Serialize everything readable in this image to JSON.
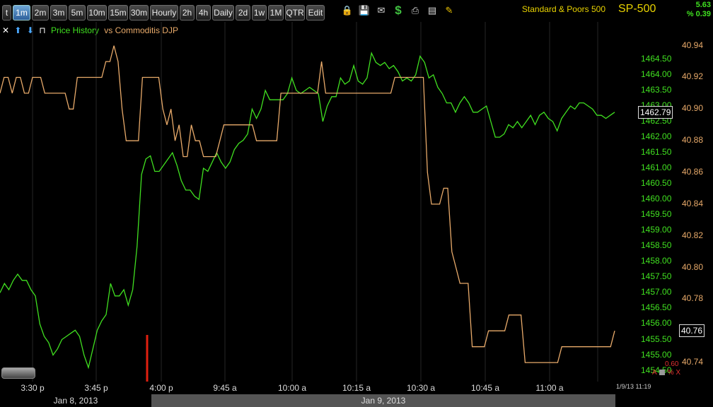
{
  "toolbar": {
    "timeframes": [
      {
        "label": "t",
        "active": false
      },
      {
        "label": "1m",
        "active": true
      },
      {
        "label": "2m",
        "active": false
      },
      {
        "label": "3m",
        "active": false
      },
      {
        "label": "5m",
        "active": false
      },
      {
        "label": "10m",
        "active": false
      },
      {
        "label": "15m",
        "active": false
      },
      {
        "label": "30m",
        "active": false
      },
      {
        "label": "Hourly",
        "active": false
      },
      {
        "label": "2h",
        "active": false
      },
      {
        "label": "4h",
        "active": false
      },
      {
        "label": "Daily",
        "active": false
      },
      {
        "label": "2d",
        "active": false
      },
      {
        "label": "1w",
        "active": false
      },
      {
        "label": "1M",
        "active": false
      },
      {
        "label": "QTR",
        "active": false
      },
      {
        "label": "Edit",
        "active": false
      }
    ],
    "icons": [
      "lock-icon",
      "save-icon",
      "mail-icon",
      "dollar-icon",
      "print-icon",
      "card-icon",
      "pencil-icon"
    ],
    "symbol_name": "Standard & Poors 500",
    "symbol": "SP-500",
    "change": "5.63",
    "change_pct": "% 0.39"
  },
  "legend": {
    "arrow_icons": [
      "close-icon",
      "arrow-up-icon",
      "arrow-down-icon",
      "pin-icon"
    ],
    "primary": "Price History",
    "compare": "vs Commoditis DJP"
  },
  "colors": {
    "price": "#40e020",
    "compare": "#e8aa6a",
    "grid": "#262626",
    "marker": "#e02010"
  },
  "chart_data": {
    "type": "line",
    "x_labels": [
      "3:30 p",
      "3:45 p",
      "4:00 p",
      "9:45 a",
      "10:00 a",
      "10:15 a",
      "10:30 a",
      "10:45 a",
      "11:00 a"
    ],
    "date_labels": [
      "Jan 8, 2013",
      "Jan 9, 2013"
    ],
    "y_left_ticks": [
      "1464.50",
      "1464.00",
      "1463.50",
      "1463.00",
      "1462.50",
      "1462.00",
      "1461.50",
      "1461.00",
      "1460.50",
      "1460.00",
      "1459.50",
      "1459.00",
      "1458.50",
      "1458.00",
      "1457.50",
      "1457.00",
      "1456.50",
      "1456.00",
      "1455.50",
      "1455.00",
      "1454.50"
    ],
    "y_right_ticks": [
      "40.94",
      "40.92",
      "40.90",
      "40.88",
      "40.86",
      "40.84",
      "40.82",
      "40.80",
      "40.78",
      "40.76",
      "40.74"
    ],
    "ylim_price": [
      1454.15,
      1465.7
    ],
    "ylim_compare": [
      40.728,
      40.955
    ],
    "current_price": "1462.79",
    "current_compare": "40.76",
    "series": [
      {
        "name": "Price History",
        "color": "#40e020",
        "values": [
          1457.0,
          1457.3,
          1457.1,
          1457.4,
          1457.6,
          1457.4,
          1457.4,
          1457.1,
          1456.9,
          1456.0,
          1455.6,
          1455.4,
          1455.0,
          1455.2,
          1455.5,
          1455.6,
          1455.7,
          1455.8,
          1455.6,
          1455.0,
          1454.6,
          1455.2,
          1455.8,
          1456.1,
          1456.3,
          1457.3,
          1456.9,
          1456.9,
          1457.1,
          1456.6,
          1457.1,
          1458.5,
          1460.8,
          1461.3,
          1461.4,
          1460.9,
          1460.9,
          1461.1,
          1461.3,
          1461.5,
          1461.1,
          1460.6,
          1460.3,
          1460.3,
          1460.1,
          1460.0,
          1461.0,
          1460.9,
          1461.2,
          1461.5,
          1461.2,
          1461.0,
          1461.2,
          1461.6,
          1461.8,
          1461.9,
          1462.1,
          1462.9,
          1462.6,
          1462.9,
          1463.5,
          1463.2,
          1463.2,
          1463.2,
          1463.2,
          1463.4,
          1463.9,
          1463.5,
          1463.4,
          1463.5,
          1463.6,
          1463.5,
          1463.4,
          1462.5,
          1463.0,
          1463.3,
          1463.3,
          1463.9,
          1463.7,
          1463.8,
          1464.3,
          1463.8,
          1463.7,
          1463.9,
          1464.7,
          1464.4,
          1464.3,
          1464.4,
          1464.2,
          1464.3,
          1464.1,
          1463.8,
          1463.9,
          1463.8,
          1464.0,
          1464.6,
          1464.4,
          1463.9,
          1464.0,
          1463.6,
          1463.4,
          1463.1,
          1463.1,
          1462.8,
          1463.1,
          1463.3,
          1463.1,
          1462.8,
          1462.8,
          1462.9,
          1463.0,
          1462.5,
          1462.0,
          1462.0,
          1462.1,
          1462.4,
          1462.3,
          1462.5,
          1462.3,
          1462.5,
          1462.7,
          1462.4,
          1462.7,
          1462.8,
          1462.6,
          1462.5,
          1462.2,
          1462.6,
          1462.8,
          1463.0,
          1462.9,
          1463.1,
          1463.1,
          1463.0,
          1462.9,
          1462.7,
          1462.7,
          1462.6,
          1462.7,
          1462.8
        ]
      },
      {
        "name": "vs Commoditis DJP",
        "color": "#e8aa6a",
        "values": [
          40.91,
          40.92,
          40.92,
          40.91,
          40.92,
          40.92,
          40.91,
          40.91,
          40.92,
          40.92,
          40.92,
          40.91,
          40.91,
          40.91,
          40.91,
          40.91,
          40.91,
          40.9,
          40.9,
          40.92,
          40.92,
          40.92,
          40.92,
          40.92,
          40.92,
          40.92,
          40.93,
          40.93,
          40.94,
          40.93,
          40.9,
          40.88,
          40.88,
          40.88,
          40.88,
          40.92,
          40.92,
          40.92,
          40.92,
          40.92,
          40.9,
          40.89,
          40.9,
          40.88,
          40.89,
          40.87,
          40.87,
          40.89,
          40.88,
          40.88,
          40.87,
          40.87,
          40.87,
          40.87,
          40.88,
          40.89,
          40.89,
          40.89,
          40.89,
          40.89,
          40.89,
          40.89,
          40.89,
          40.88,
          40.88,
          40.88,
          40.88,
          40.88,
          40.88,
          40.91,
          40.91,
          40.91,
          40.91,
          40.91,
          40.91,
          40.91,
          40.91,
          40.91,
          40.91,
          40.93,
          40.91,
          40.91,
          40.91,
          40.91,
          40.91,
          40.91,
          40.91,
          40.91,
          40.91,
          40.91,
          40.91,
          40.91,
          40.91,
          40.91,
          40.91,
          40.91,
          40.91,
          40.92,
          40.92,
          40.92,
          40.92,
          40.92,
          40.92,
          40.92,
          40.92,
          40.86,
          40.84,
          40.84,
          40.84,
          40.85,
          40.85,
          40.81,
          40.8,
          40.79,
          40.79,
          40.79,
          40.75,
          40.75,
          40.75,
          40.75,
          40.76,
          40.76,
          40.76,
          40.76,
          40.76,
          40.77,
          40.77,
          40.77,
          40.77,
          40.74,
          40.74,
          40.74,
          40.74,
          40.74,
          40.74,
          40.74,
          40.74,
          40.74,
          40.75,
          40.75,
          40.75,
          40.75,
          40.75,
          40.75,
          40.75,
          40.75,
          40.75,
          40.75,
          40.75,
          40.75,
          40.75,
          40.76
        ]
      }
    ],
    "grid": true,
    "session_marker": "4:00 p"
  },
  "footer": {
    "timestamp": "1/9/13 11:19",
    "zoom_value": "0.60",
    "auto_label": "A",
    "pct_label": "%",
    "close_label": "X"
  }
}
